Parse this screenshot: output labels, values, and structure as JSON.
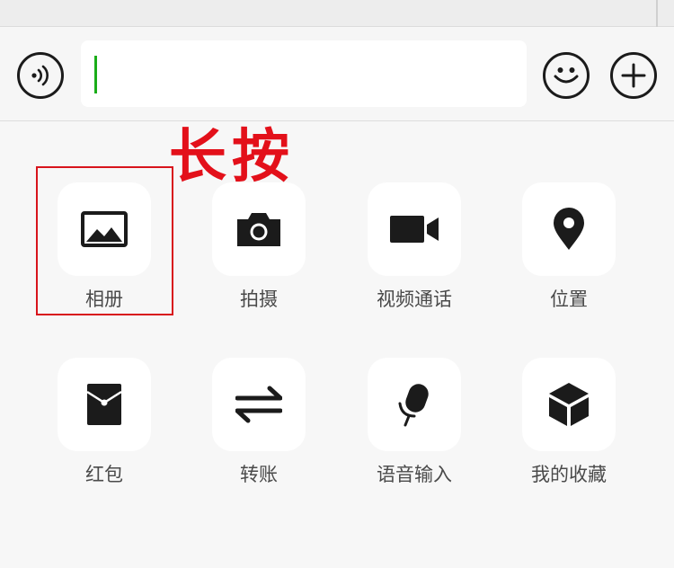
{
  "input_bar": {
    "text_value": "",
    "voice_icon": "voice-icon",
    "emoji_icon": "emoji-icon",
    "plus_icon": "plus-icon"
  },
  "annotation": {
    "hint": "长按",
    "color": "#e3101a"
  },
  "panel": {
    "items": [
      {
        "label": "相册",
        "icon": "photo-album-icon"
      },
      {
        "label": "拍摄",
        "icon": "camera-icon"
      },
      {
        "label": "视频通话",
        "icon": "video-call-icon"
      },
      {
        "label": "位置",
        "icon": "location-icon"
      },
      {
        "label": "红包",
        "icon": "red-packet-icon"
      },
      {
        "label": "转账",
        "icon": "transfer-icon"
      },
      {
        "label": "语音输入",
        "icon": "voice-input-icon"
      },
      {
        "label": "我的收藏",
        "icon": "favorites-icon"
      }
    ]
  },
  "colors": {
    "accent_caret": "#1aad19",
    "icon": "#1b1b1b",
    "background": "#f7f7f7"
  }
}
